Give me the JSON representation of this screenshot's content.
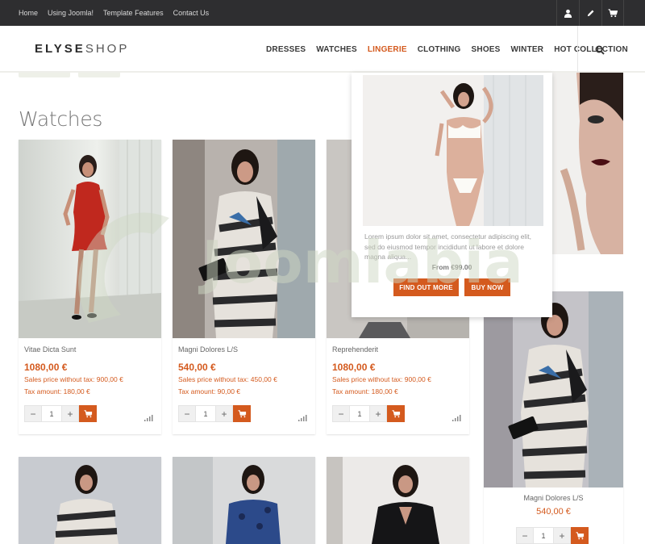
{
  "topbar": {
    "links": [
      "Home",
      "Using Joomla!",
      "Template Features",
      "Contact Us"
    ],
    "icons": [
      "user-icon",
      "pencil-icon",
      "cart-icon"
    ]
  },
  "header": {
    "logo_bold": "ELYSE",
    "logo_thin": "SHOP",
    "nav": [
      "DRESSES",
      "WATCHES",
      "LINGERIE",
      "CLOTHING",
      "SHOES",
      "WINTER",
      "HOT COLLECTION"
    ],
    "active_nav": "LINGERIE",
    "search_icon": "search-icon"
  },
  "page": {
    "title": "Watches"
  },
  "products": [
    {
      "name": "Vitae Dicta Sunt",
      "price": "1080,00 €",
      "sales": "Sales price without tax: 900,00 €",
      "tax": "Tax amount: 180,00 €",
      "qty": "1"
    },
    {
      "name": "Magni Dolores L/S",
      "price": "540,00 €",
      "sales": "Sales price without tax: 450,00 €",
      "tax": "Tax amount: 90,00 €",
      "qty": "1"
    },
    {
      "name": "Reprehenderit",
      "price": "1080,00 €",
      "sales": "Sales price without tax: 900,00 €",
      "tax": "Tax amount: 180,00 €",
      "qty": "1"
    }
  ],
  "right_product": {
    "name": "Magni Dolores L/S",
    "price": "540,00 €",
    "qty": "1"
  },
  "mega_menu": {
    "description": "Lorem ipsum dolor sit amet, consectetur adipiscing elit, sed do eiusmod tempor incididunt ut labore et dolore magna aliqua...",
    "from_price": "From €99.00",
    "find_out_more": "FIND OUT MORE",
    "buy_now": "BUY NOW"
  },
  "qty_controls": {
    "minus": "−",
    "plus": "+"
  },
  "watermark": "Joomlabia",
  "colors": {
    "accent": "#d45a1e",
    "topbar": "#2e2e30",
    "text": "#555555"
  }
}
